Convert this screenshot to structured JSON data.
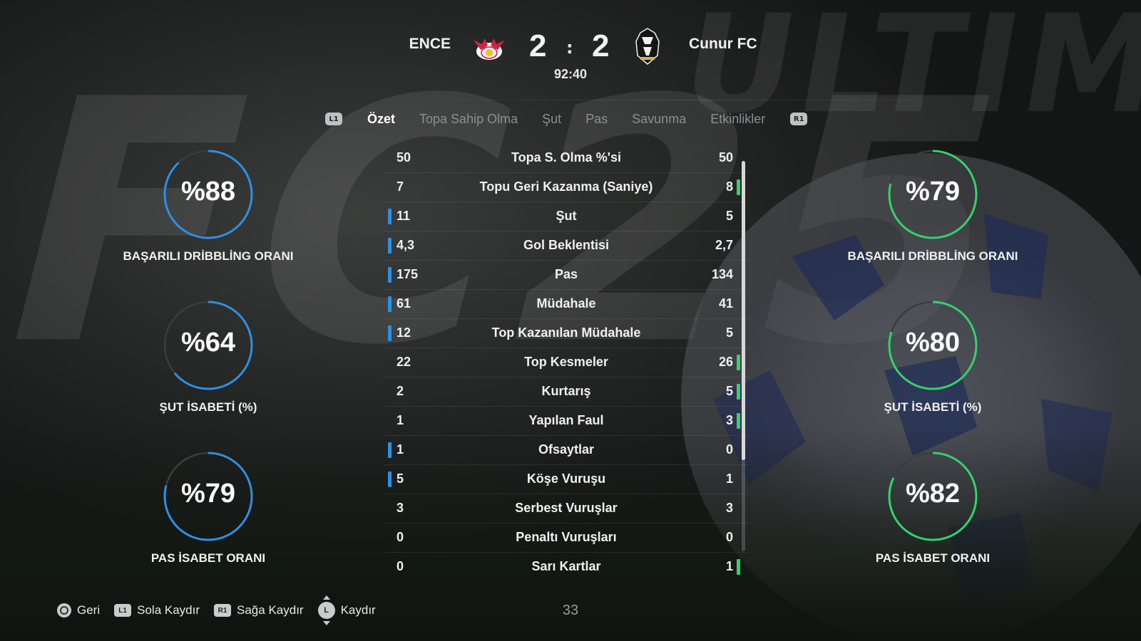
{
  "match": {
    "home_team": "ENCE",
    "away_team": "Cunur FC",
    "home_score": "2",
    "away_score": "2",
    "separator": ":",
    "clock": "92:40"
  },
  "tabs": {
    "left_shoulder": "L1",
    "right_shoulder": "R1",
    "items": [
      {
        "label": "Özet",
        "active": true
      },
      {
        "label": "Topa Sahip Olma",
        "active": false
      },
      {
        "label": "Şut",
        "active": false
      },
      {
        "label": "Pas",
        "active": false
      },
      {
        "label": "Savunma",
        "active": false
      },
      {
        "label": "Etkinlikler",
        "active": false
      }
    ]
  },
  "home_rings": [
    {
      "value": "%88",
      "percent": 88,
      "label": "BAŞARILI DRİBBLİNG ORANI"
    },
    {
      "value": "%64",
      "percent": 64,
      "label": "ŞUT İSABETİ (%)"
    },
    {
      "value": "%79",
      "percent": 79,
      "label": "PAS İSABET ORANI"
    }
  ],
  "away_rings": [
    {
      "value": "%79",
      "percent": 79,
      "label": "BAŞARILI DRİBBLİNG ORANI"
    },
    {
      "value": "%80",
      "percent": 80,
      "label": "ŞUT İSABETİ (%)"
    },
    {
      "value": "%82",
      "percent": 82,
      "label": "PAS İSABET ORANI"
    }
  ],
  "colors": {
    "home_accent": "#2f8fe0",
    "away_accent": "#35d16a",
    "ring_track": "#3a3c3d"
  },
  "stats": [
    {
      "name": "Topa S. Olma %'si",
      "home": "50",
      "away": "50",
      "leader": "none"
    },
    {
      "name": "Topu Geri Kazanma (Saniye)",
      "home": "7",
      "away": "8",
      "leader": "away"
    },
    {
      "name": "Şut",
      "home": "11",
      "away": "5",
      "leader": "home"
    },
    {
      "name": "Gol Beklentisi",
      "home": "4,3",
      "away": "2,7",
      "leader": "home"
    },
    {
      "name": "Pas",
      "home": "175",
      "away": "134",
      "leader": "home"
    },
    {
      "name": "Müdahale",
      "home": "61",
      "away": "41",
      "leader": "home"
    },
    {
      "name": "Top Kazanılan Müdahale",
      "home": "12",
      "away": "5",
      "leader": "home"
    },
    {
      "name": "Top Kesmeler",
      "home": "22",
      "away": "26",
      "leader": "away"
    },
    {
      "name": "Kurtarış",
      "home": "2",
      "away": "5",
      "leader": "away"
    },
    {
      "name": "Yapılan Faul",
      "home": "1",
      "away": "3",
      "leader": "away"
    },
    {
      "name": "Ofsaytlar",
      "home": "1",
      "away": "0",
      "leader": "home"
    },
    {
      "name": "Köşe Vuruşu",
      "home": "5",
      "away": "1",
      "leader": "home"
    },
    {
      "name": "Serbest Vuruşlar",
      "home": "3",
      "away": "3",
      "leader": "none"
    },
    {
      "name": "Penaltı Vuruşları",
      "home": "0",
      "away": "0",
      "leader": "none"
    },
    {
      "name": "Sarı Kartlar",
      "home": "0",
      "away": "1",
      "leader": "away"
    }
  ],
  "footer": {
    "back": {
      "icon": "circle-button-icon",
      "label": "Geri"
    },
    "scroll_left": {
      "icon": "L1",
      "label": "Sola Kaydır"
    },
    "scroll_right": {
      "icon": "R1",
      "label": "Sağa Kaydır"
    },
    "scroll": {
      "icon": "L",
      "label": "Kaydır"
    },
    "page_number": "33"
  },
  "background_text": [
    "FC25",
    "ULTIMATE"
  ]
}
